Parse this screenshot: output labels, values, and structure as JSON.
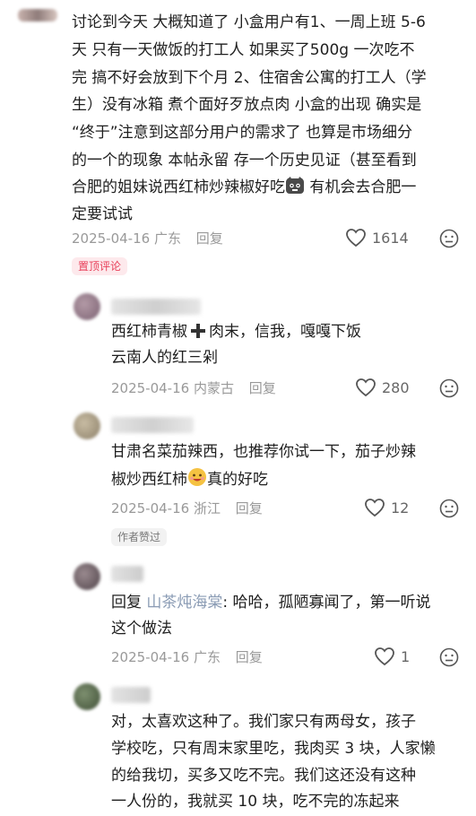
{
  "comments": [
    {
      "lines": [
        "讨论到今天 大概知道了 小盒用户有1、一周上班 5-6",
        "天 只有一天做饭的打工人 如果买了500g 一次吃不",
        "完 搞不好会放到下个月 2、住宿舍公寓的打工人（学",
        "生）没有冰箱 煮个面好歹放点肉 小盒的出现 确实是",
        "“终于”注意到这部分用户的需求了 也算是市场细分",
        "的一个的现象 本帖永留 存一个历史见证（甚至看到",
        "合肥的姐妹说西红柿炒辣椒好吃",
        "定要试试"
      ],
      "line7_suffix": " 有机会去合肥一",
      "date": "2025-04-16",
      "location": "广东",
      "reply_label": "回复",
      "likes": "1614",
      "badge": "置顶评论"
    },
    {
      "line1_a": "西红柿青椒",
      "line1_b": "肉末，信我，嘎嘎下饭",
      "line2": "云南人的红三剁",
      "date": "2025-04-16",
      "location": "内蒙古",
      "reply_label": "回复",
      "likes": "280"
    },
    {
      "line1": "甘肃名菜茄辣西，也推荐你试一下，茄子炒辣",
      "line2_a": "椒炒西红柿",
      "line2_b": "真的好吃",
      "date": "2025-04-16",
      "location": "浙江",
      "reply_label": "回复",
      "likes": "12",
      "badge": "作者赞过"
    },
    {
      "reply_prefix": "回复",
      "mention": "山茶炖海棠",
      "line1_rest": ": 哈哈，孤陋寡闻了，第一听说",
      "line2": "这个做法",
      "date": "2025-04-16",
      "location": "广东",
      "reply_label": "回复",
      "likes": "1"
    },
    {
      "lines": [
        "对，太喜欢这种了。我们家只有两母女，孩子",
        "学校吃，只有周末家里吃，我肉买 3 块，人家懒",
        "的给我切，买多又吃不完。我们这还没有这种",
        "一人份的，我就买 10 块，吃不完的冻起来"
      ]
    }
  ],
  "colors": {
    "text": "#1f1f1f",
    "meta": "#999999",
    "pinned_badge_bg": "#fde9ec",
    "pinned_badge_text": "#e8405a",
    "author_badge_bg": "#f2f2f2",
    "author_badge_text": "#777777",
    "mention": "#8a9bb4"
  }
}
